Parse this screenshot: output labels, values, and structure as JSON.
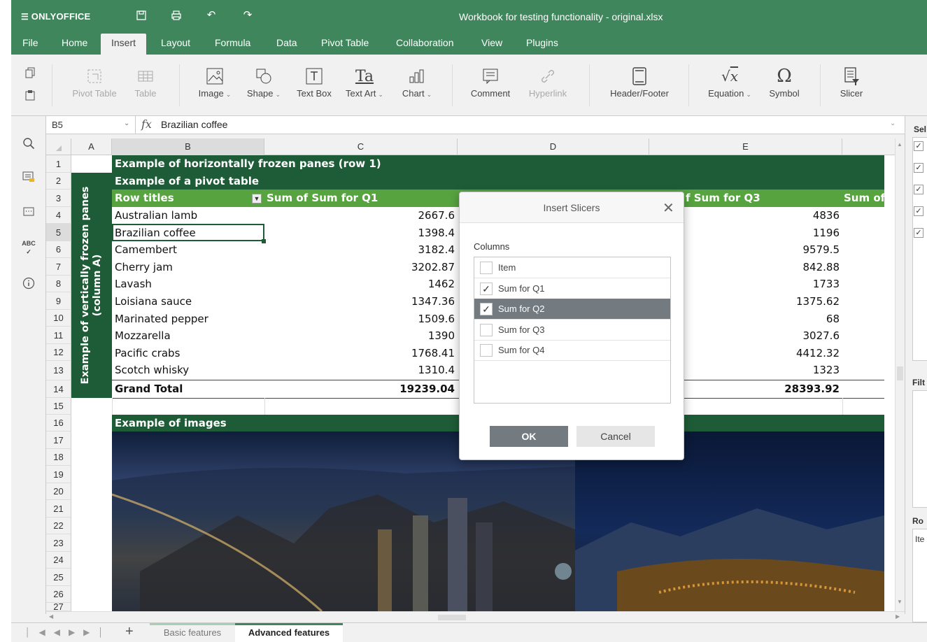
{
  "app": {
    "name": "ONLYOFFICE",
    "title": "Workbook for testing functionality - original.xlsx"
  },
  "menu": [
    "File",
    "Home",
    "Insert",
    "Layout",
    "Formula",
    "Data",
    "Pivot Table",
    "Collaboration",
    "View",
    "Plugins"
  ],
  "toolbar": {
    "pivot_table": "Pivot Table",
    "table": "Table",
    "image": "Image",
    "shape": "Shape",
    "text_box": "Text Box",
    "text_art": "Text Art",
    "chart": "Chart",
    "comment": "Comment",
    "hyperlink": "Hyperlink",
    "header_footer": "Header/Footer",
    "equation": "Equation",
    "symbol": "Symbol",
    "slicer": "Slicer"
  },
  "formula": {
    "cell_ref": "B5",
    "fx": "fx",
    "value": "Brazilian coffee"
  },
  "columns": [
    "A",
    "B",
    "C",
    "D",
    "E"
  ],
  "rows": [
    "1",
    "2",
    "3",
    "4",
    "5",
    "6",
    "7",
    "8",
    "9",
    "10",
    "11",
    "12",
    "13",
    "14",
    "15",
    "16",
    "17",
    "18",
    "19",
    "20",
    "21",
    "22",
    "23",
    "24",
    "25",
    "26",
    "27"
  ],
  "sheet": {
    "row1": "Example of horizontally frozen panes (row 1)",
    "row2": "Example of a pivot table",
    "vertical": "Example of vertically frozen panes (column A)",
    "header_b": "Row titles",
    "header_c": "Sum of Sum for Q1",
    "header_e": "f Sum for Q3",
    "header_f": "Sum of",
    "data": [
      {
        "name": "Australian lamb",
        "q1": "2667.6",
        "q3": "4836"
      },
      {
        "name": "Brazilian coffee",
        "q1": "1398.4",
        "q3": "1196"
      },
      {
        "name": "Camembert",
        "q1": "3182.4",
        "q3": "9579.5"
      },
      {
        "name": "Cherry jam",
        "q1": "3202.87",
        "q3": "842.88"
      },
      {
        "name": "Lavash",
        "q1": "1462",
        "q3": "1733"
      },
      {
        "name": "Loisiana sauce",
        "q1": "1347.36",
        "q3": "1375.62"
      },
      {
        "name": "Marinated pepper",
        "q1": "1509.6",
        "q3": "68"
      },
      {
        "name": "Mozzarella",
        "q1": "1390",
        "q3": "3027.6"
      },
      {
        "name": "Pacific crabs",
        "q1": "1768.41",
        "q3": "4412.32"
      },
      {
        "name": "Scotch whisky",
        "q1": "1310.4",
        "q3": "1323"
      }
    ],
    "grand_total": {
      "name": "Grand Total",
      "q1": "19239.04",
      "q3": "28393.92"
    },
    "row16": "Example of images"
  },
  "dialog": {
    "title": "Insert Slicers",
    "columns_label": "Columns",
    "items": [
      {
        "label": "Item",
        "checked": false
      },
      {
        "label": "Sum for Q1",
        "checked": true
      },
      {
        "label": "Sum for Q2",
        "checked": true
      },
      {
        "label": "Sum for Q3",
        "checked": false
      },
      {
        "label": "Sum for Q4",
        "checked": false
      }
    ],
    "ok": "OK",
    "cancel": "Cancel"
  },
  "right_panel": {
    "sel": "Sel",
    "filt": "Filt",
    "ro": "Ro",
    "ite": "Ite"
  },
  "tabs": [
    {
      "label": "Basic features",
      "active": false
    },
    {
      "label": "Advanced features",
      "active": true
    }
  ],
  "colors": {
    "brand": "#40865c",
    "header_dark": "#1e5c37",
    "header_green": "#56a33f",
    "selected_row": "#737a80"
  }
}
